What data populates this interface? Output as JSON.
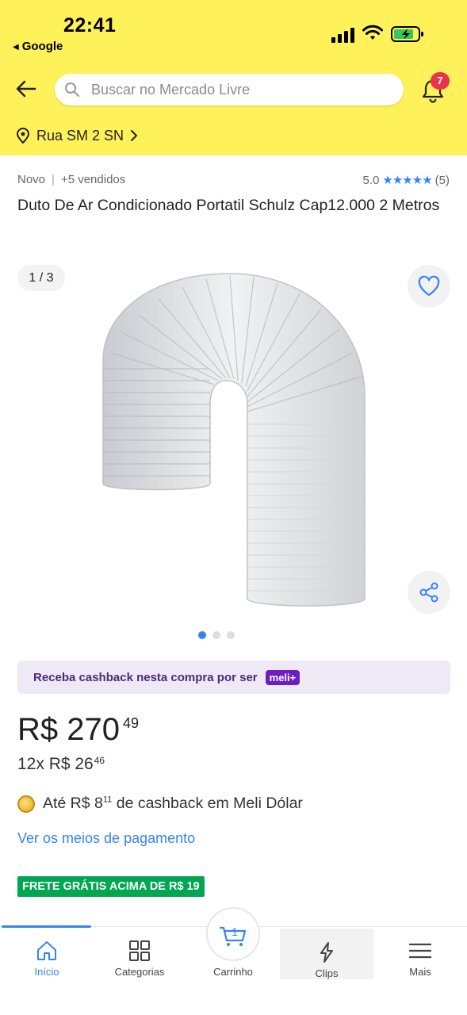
{
  "status_bar": {
    "time": "22:41",
    "back_app": "Google"
  },
  "header": {
    "search_placeholder": "Buscar no Mercado Livre",
    "notification_count": "7",
    "address": "Rua SM 2 SN"
  },
  "product": {
    "condition": "Novo",
    "sold": "+5 vendidos",
    "rating_value": "5.0",
    "rating_stars": 5,
    "rating_count": "(5)",
    "title": "Duto De Ar Condicionado Portatil  Schulz  Cap12.000 2 Metros",
    "image_counter": "1 / 3",
    "image_index": 1,
    "image_total": 3
  },
  "cashback_banner": {
    "text": "Receba cashback nesta compra por ser",
    "badge": "meli+"
  },
  "price": {
    "main": "R$ 270",
    "cents": "49",
    "installments_main": "12x R$ 26",
    "installments_cents": "46"
  },
  "cashback": {
    "prefix": "Até R$ 8",
    "cents": "11",
    "suffix": " de cashback em Meli Dólar"
  },
  "payment_link": "Ver os meios de pagamento",
  "shipping_tag": "FRETE GRÁTIS ACIMA DE R$ 19",
  "tabbar": {
    "items": [
      {
        "label": "Início",
        "icon": "home-icon",
        "active": true
      },
      {
        "label": "Categorias",
        "icon": "grid-icon",
        "active": false
      },
      {
        "label": "Carrinho",
        "icon": "cart-icon",
        "active": false,
        "badge": "1"
      },
      {
        "label": "Clips",
        "icon": "lightning-icon",
        "active": false
      },
      {
        "label": "Mais",
        "icon": "menu-icon",
        "active": false
      }
    ]
  },
  "colors": {
    "header_yellow": "#fff159",
    "link_blue": "#3483fa",
    "green": "#00a650",
    "badge_red": "#e8344c",
    "meli_purple": "#6b1fbf"
  }
}
